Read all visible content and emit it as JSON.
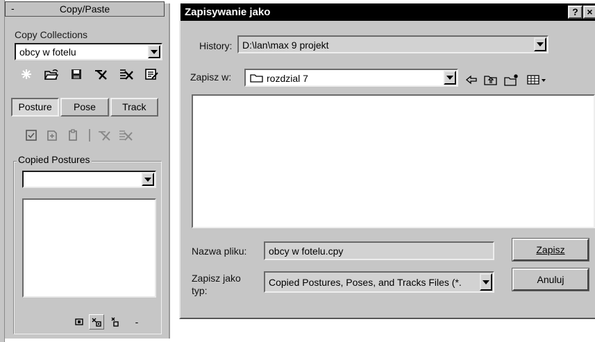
{
  "panel": {
    "rollout_title": "Copy/Paste",
    "rollout_toggle": "-",
    "collections_label": "Copy Collections",
    "collection_value": "obcy w fotelu",
    "tabs": [
      "Posture",
      "Pose",
      "Track"
    ],
    "copied_label": "Copied Postures",
    "copied_value": "",
    "bottom_minus": "-"
  },
  "dialog": {
    "title": "Zapisywanie jako",
    "help_button": "?",
    "close_button": "×",
    "history_label": "History:",
    "history_value": "D:\\lan\\max 9 projekt",
    "savein_label": "Zapisz w:",
    "savein_value": "rozdzial 7",
    "filename_label": "Nazwa pliku:",
    "filename_value": "obcy w fotelu.cpy",
    "filetype_label_1": "Zapisz jako",
    "filetype_label_2": "typ:",
    "filetype_value": "Copied Postures, Poses, and Tracks Files (*.",
    "save_button": "Zapisz",
    "cancel_button": "Anuluj"
  }
}
